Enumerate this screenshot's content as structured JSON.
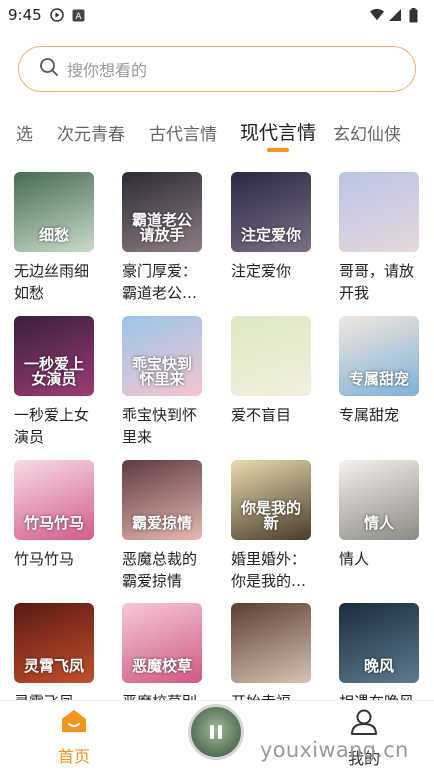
{
  "status_bar": {
    "time": "9:45",
    "icons": [
      "play-circle-icon",
      "a-box-icon",
      "wifi-icon",
      "signal-icon",
      "battery-icon"
    ]
  },
  "search": {
    "placeholder": "搜你想看的",
    "icon": "search-icon",
    "border_color": "#f2b47e"
  },
  "tabs": [
    {
      "label": "精选",
      "visible_text": "选",
      "active": false
    },
    {
      "label": "次元青春",
      "active": false
    },
    {
      "label": "古代言情",
      "active": false
    },
    {
      "label": "现代言情",
      "active": true
    },
    {
      "label": "玄幻仙侠",
      "active": false
    }
  ],
  "accent_color": "#f7941d",
  "books": [
    {
      "title": "无边丝雨细如愁",
      "cover_text": "细愁",
      "cover_colors": [
        "#486a52",
        "#c9dcc8"
      ]
    },
    {
      "title": "豪门厚爱：霸道老公…",
      "cover_text": "霸道老公请放手",
      "cover_colors": [
        "#2d2a35",
        "#8e7c84"
      ]
    },
    {
      "title": "注定爱你",
      "cover_text": "注定爱你",
      "cover_colors": [
        "#2a2744",
        "#7b6f86"
      ]
    },
    {
      "title": "哥哥，请放开我",
      "cover_text": "",
      "cover_colors": [
        "#b9c6e6",
        "#e7d5dc"
      ]
    },
    {
      "title": "一秒爱上女演员",
      "cover_text": "一秒爱上女演员",
      "cover_colors": [
        "#3a1f3f",
        "#9b3c73"
      ]
    },
    {
      "title": "乖宝快到怀里来",
      "cover_text": "乖宝快到怀里来",
      "cover_colors": [
        "#9bc5e9",
        "#f3c5d0"
      ]
    },
    {
      "title": "爱不盲目",
      "cover_text": "",
      "cover_colors": [
        "#dce9c0",
        "#f3efe0"
      ]
    },
    {
      "title": "专属甜宠",
      "cover_text": "专属甜宠",
      "cover_colors": [
        "#f2e7de",
        "#7fb2d8"
      ]
    },
    {
      "title": "竹马竹马",
      "cover_text": "竹马竹马",
      "cover_colors": [
        "#f7dce6",
        "#d35b8d"
      ]
    },
    {
      "title": "恶魔总裁的霸爱掠情",
      "cover_text": "霸爱掠情",
      "cover_colors": [
        "#5e3b3f",
        "#e7b8b0"
      ]
    },
    {
      "title": "婚里婚外：你是我的…",
      "cover_text": "你是我的新",
      "cover_colors": [
        "#e8dcae",
        "#4a3b2a"
      ]
    },
    {
      "title": "情人",
      "cover_text": "情人",
      "cover_colors": [
        "#f4f1ee",
        "#8d8a84"
      ]
    },
    {
      "title": "灵霄飞凤",
      "cover_text": "灵霄飞凤",
      "cover_colors": [
        "#5b1a12",
        "#c24f2c"
      ]
    },
    {
      "title": "恶魔校草别",
      "cover_text": "恶魔校草",
      "cover_colors": [
        "#f5c9d6",
        "#d05884"
      ]
    },
    {
      "title": "开始幸福",
      "cover_text": "",
      "cover_colors": [
        "#5a3f33",
        "#d8c2b3"
      ]
    },
    {
      "title": "相遇在晚风",
      "cover_text": "晚风",
      "cover_colors": [
        "#1b2c3c",
        "#5d7a8f"
      ]
    }
  ],
  "bottom_nav": {
    "home_label": "首页",
    "mine_label": "我的"
  },
  "watermark": "youxiwang.cn"
}
